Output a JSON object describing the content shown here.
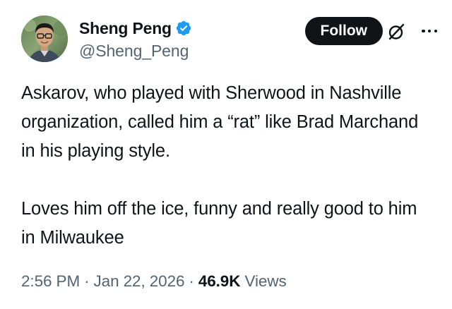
{
  "author": {
    "display_name": "Sheng Peng",
    "handle": "@Sheng_Peng",
    "verified": true,
    "avatar_icon": "user-avatar-photo"
  },
  "actions": {
    "follow_label": "Follow",
    "grok_icon": "grok-icon",
    "more_icon": "more-icon"
  },
  "tweet": {
    "paragraphs": [
      "Askarov, who played with Sherwood in Nashville organization, called him a “rat” like Brad Marchand in his playing style.",
      "Loves him off the ice, funny and really good to him in Milwaukee"
    ]
  },
  "meta": {
    "time": "2:56 PM",
    "separator": "·",
    "date": "Jan 22, 2026",
    "views_count": "46.9K",
    "views_label": "Views"
  },
  "colors": {
    "text_primary": "#0f1419",
    "text_secondary": "#536471",
    "verified_badge": "#1d9bf0",
    "follow_bg": "#0f1419",
    "background": "#ffffff"
  }
}
